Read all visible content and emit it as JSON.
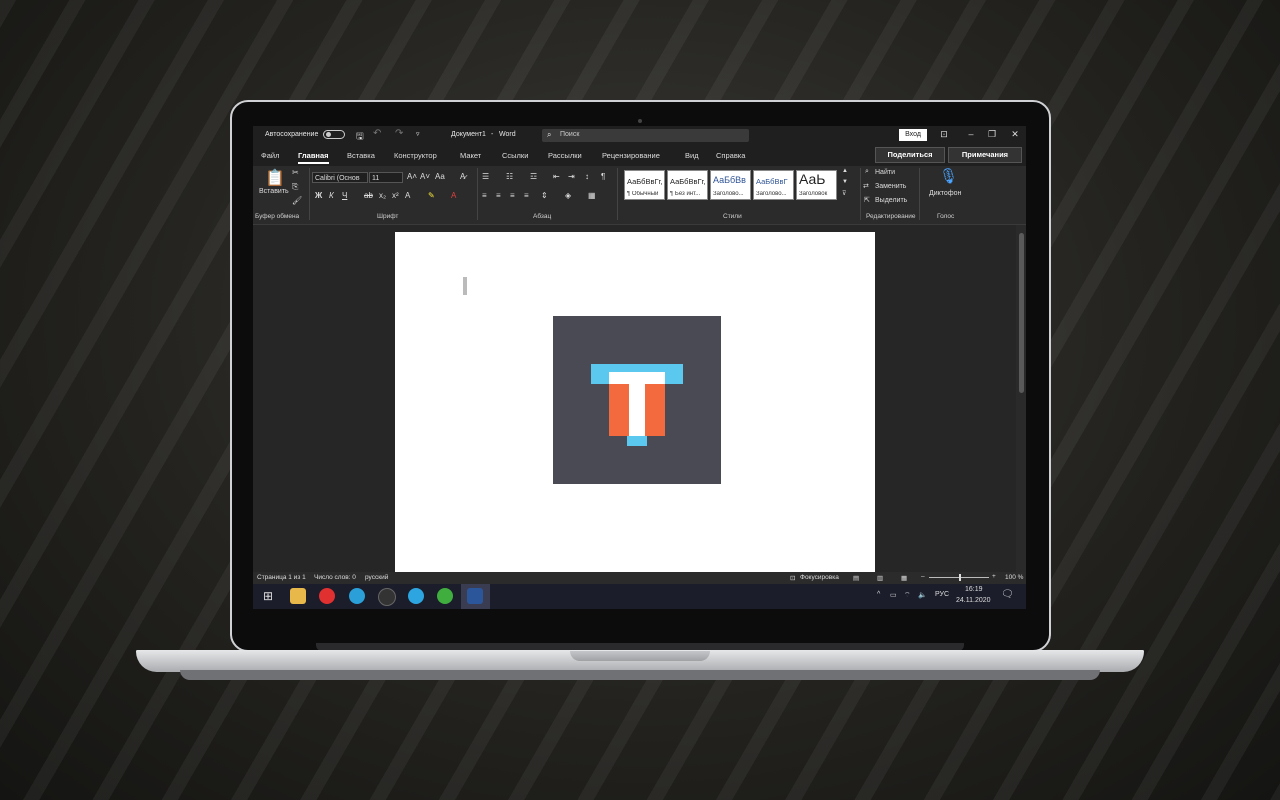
{
  "titlebar": {
    "autosave_label": "Автосохранение",
    "doc_title": "Документ1",
    "separator": "-",
    "app_name": "Word",
    "search_placeholder": "Поиск",
    "login_label": "Вход"
  },
  "tabs": [
    "Файл",
    "Главная",
    "Вставка",
    "Конструктор",
    "Макет",
    "Ссылки",
    "Рассылки",
    "Рецензирование",
    "Вид",
    "Справка"
  ],
  "share_label": "Поделиться",
  "comments_label": "Примечания",
  "ribbon": {
    "clipboard": {
      "paste_label": "Вставить",
      "group_label": "Буфер обмена"
    },
    "font": {
      "font_name": "Calibri (Основ",
      "font_size": "11",
      "group_label": "Шрифт"
    },
    "paragraph": {
      "group_label": "Абзац"
    },
    "styles": {
      "group_label": "Стили",
      "items": [
        {
          "sample": "АаБбВвГг,",
          "name": "¶ Обычный"
        },
        {
          "sample": "АаБбВвГг,",
          "name": "¶ Без инт..."
        },
        {
          "sample": "АаБбВв",
          "name": "Заголово..."
        },
        {
          "sample": "АаБбВвГ",
          "name": "Заголово..."
        },
        {
          "sample": "АаЬ",
          "name": "Заголовок"
        }
      ]
    },
    "editing": {
      "find": "Найти",
      "replace": "Заменить",
      "select": "Выделить",
      "group_label": "Редактирование"
    },
    "voice": {
      "dictate": "Диктофон",
      "group_label": "Голос"
    }
  },
  "statusbar": {
    "page": "Страница 1 из 1",
    "words": "Число слов: 0",
    "language": "русский",
    "focus": "Фокусировка",
    "zoom": "100 %"
  },
  "taskbar": {
    "lang": "РУС",
    "time": "16:19",
    "date": "24.11.2020"
  },
  "colors": {
    "logo_bg": "#4a4a54",
    "logo_cyan": "#5bc8f0",
    "logo_orange": "#f26a3d",
    "word_blue": "#2b579a"
  }
}
